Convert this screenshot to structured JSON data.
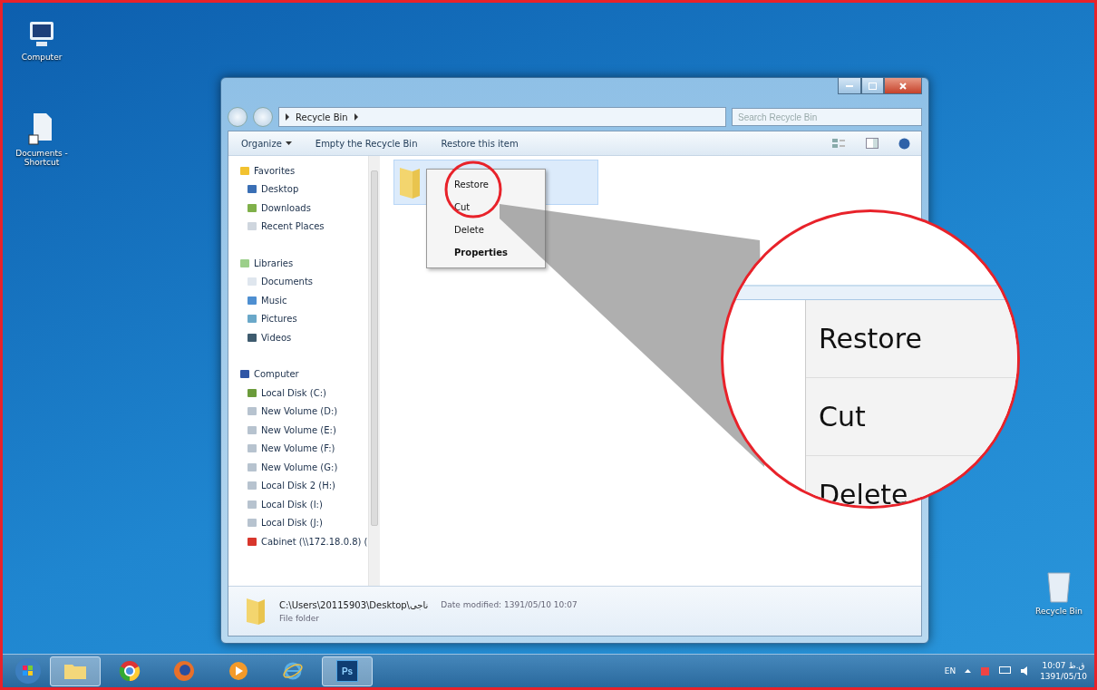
{
  "desktop_icons": [
    {
      "kind": "computer",
      "label": "Computer"
    },
    {
      "kind": "shortcut",
      "label": "Documents - Shortcut"
    },
    {
      "kind": "recycle",
      "label": "Recycle Bin"
    }
  ],
  "window": {
    "address": "Recycle Bin",
    "search": {
      "placeholder": "Search Recycle Bin"
    },
    "toolbar": [
      {
        "label": "Organize",
        "kind": "menu"
      },
      {
        "label": "Empty the Recycle Bin",
        "kind": "action"
      },
      {
        "label": "Restore this item",
        "kind": "action"
      }
    ],
    "nav": [
      {
        "label": "Favorites",
        "kind": "favorites",
        "children": [
          {
            "label": "Desktop",
            "kind": "desktop"
          },
          {
            "label": "Downloads",
            "kind": "downloads"
          },
          {
            "label": "Recent Places",
            "kind": "recent"
          }
        ]
      },
      {
        "label": "Libraries",
        "kind": "library",
        "children": [
          {
            "label": "Documents",
            "kind": "document"
          },
          {
            "label": "Music",
            "kind": "music"
          },
          {
            "label": "Pictures",
            "kind": "picture"
          },
          {
            "label": "Videos",
            "kind": "video"
          }
        ]
      },
      {
        "label": "Computer",
        "kind": "computer",
        "children": [
          {
            "label": "Local Disk (C:)",
            "kind": "system"
          },
          {
            "label": "New Volume (D:)",
            "kind": "drive"
          },
          {
            "label": "New Volume (E:)",
            "kind": "drive"
          },
          {
            "label": "New Volume (F:)",
            "kind": "drive"
          },
          {
            "label": "New Volume (G:)",
            "kind": "drive"
          },
          {
            "label": "Local Disk 2 (H:)",
            "kind": "drive"
          },
          {
            "label": "Local Disk (I:)",
            "kind": "drive"
          },
          {
            "label": "Local Disk (J:)",
            "kind": "drive"
          },
          {
            "label": "Cabinet (\\\\172.18.0.8) (",
            "kind": "network"
          }
        ]
      }
    ],
    "context_menu": [
      {
        "label": "Restore",
        "default": false
      },
      {
        "label": "Cut",
        "default": false
      },
      {
        "label": "Delete",
        "default": false
      },
      {
        "label": "Properties",
        "default": true
      }
    ],
    "details": {
      "path": "C:\\Users\\20115903\\Desktop\\ناجی",
      "modified": "Date modified: 1391/05/10 10:07",
      "type": "File folder"
    }
  },
  "magnifier": {
    "items": [
      "Restore",
      "Cut",
      "Delete"
    ]
  },
  "taskbar": {
    "apps": [
      {
        "kind": "explorer",
        "active": true
      },
      {
        "kind": "chrome",
        "active": false
      },
      {
        "kind": "firefox",
        "active": false
      },
      {
        "kind": "media",
        "active": false
      },
      {
        "kind": "ie",
        "active": false
      },
      {
        "kind": "photoshop",
        "label": "Ps",
        "active": true
      }
    ],
    "tray": {
      "language": "EN",
      "time": "10:07 ق.ظ",
      "date": "1391/05/10"
    }
  }
}
